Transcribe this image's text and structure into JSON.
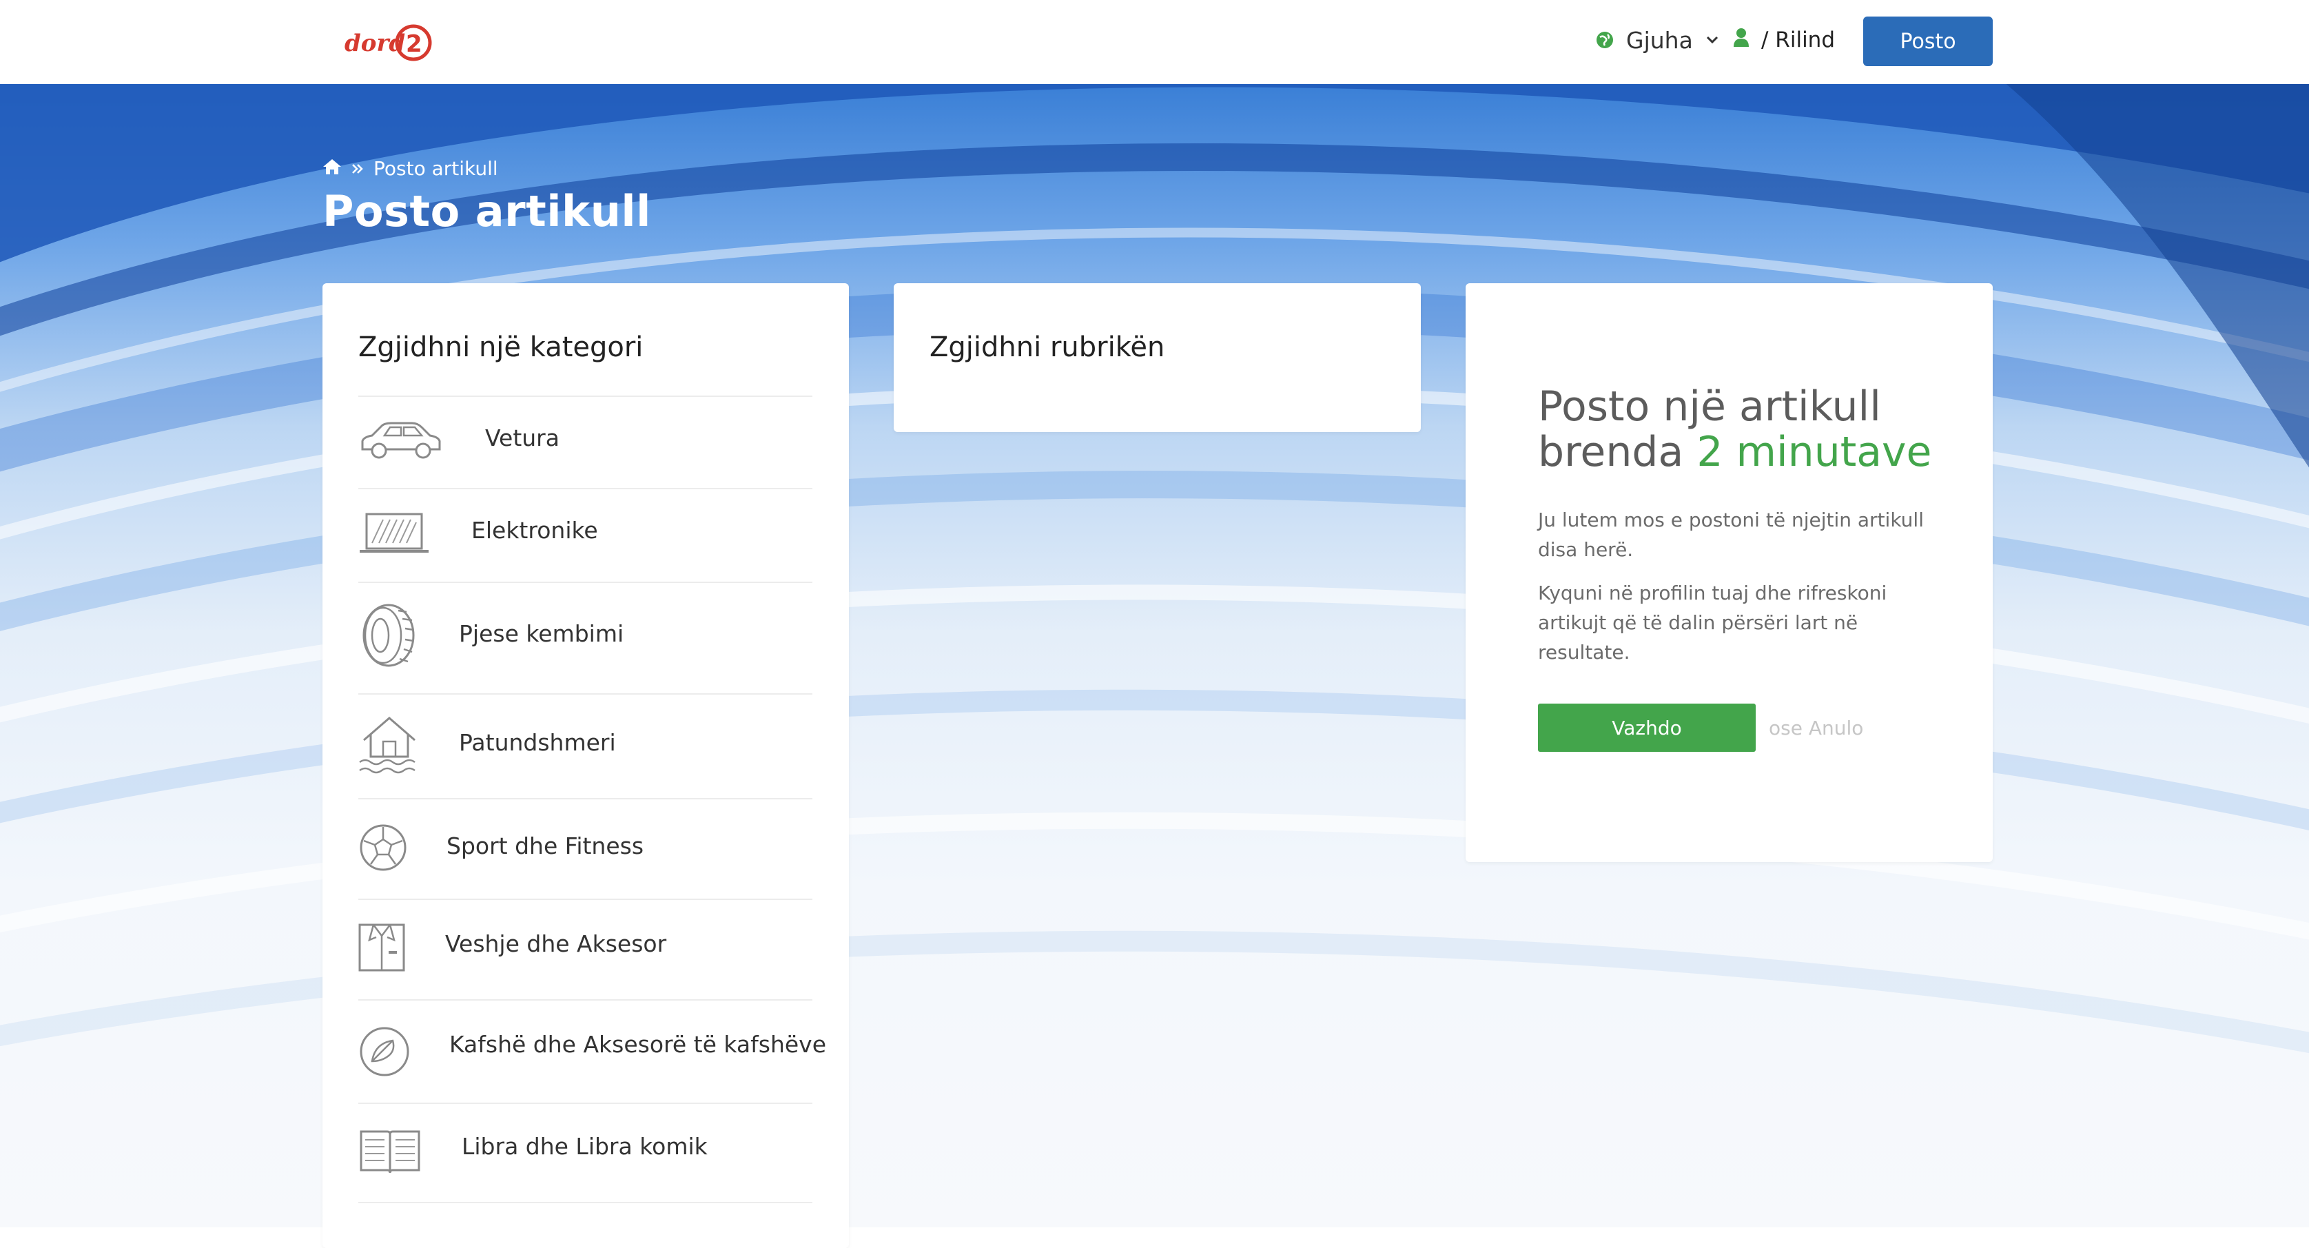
{
  "header": {
    "language_label": "Gjuha",
    "user_name": "/ Rilind",
    "post_button": "Posto"
  },
  "breadcrumb": {
    "current": "Posto artikull"
  },
  "page": {
    "title": "Posto artikull"
  },
  "categories": {
    "heading": "Zgjidhni një kategori",
    "items": [
      {
        "label": "Vetura",
        "icon": "car-icon"
      },
      {
        "label": "Elektronike",
        "icon": "laptop-icon"
      },
      {
        "label": "Pjese kembimi",
        "icon": "tire-icon"
      },
      {
        "label": "Patundshmeri",
        "icon": "house-icon"
      },
      {
        "label": "Sport dhe Fitness",
        "icon": "soccer-ball-icon"
      },
      {
        "label": "Veshje dhe Aksesor",
        "icon": "shirt-icon"
      },
      {
        "label": "Kafshë dhe Aksesorë të kafshëve",
        "icon": "pet-icon"
      },
      {
        "label": "Libra dhe Libra komik",
        "icon": "book-icon"
      }
    ]
  },
  "subcategory": {
    "heading": "Zgjidhni rubrikën"
  },
  "info": {
    "title_line1": "Posto një artikull",
    "title_line2_prefix": "brenda ",
    "title_line2_accent": "2 minutave",
    "paragraph1": "Ju lutem mos e postoni të njejtin artikull disa herë.",
    "paragraph2": "Kyquni në profilin tuaj dhe rifreskoni artikujt që të dalin përsëri lart në resultate.",
    "continue_button": "Vazhdo",
    "cancel_link": "ose Anulo"
  },
  "colors": {
    "primary_blue": "#2b6cb8",
    "success_green": "#43a54b",
    "logo_red": "#d63a2f"
  }
}
